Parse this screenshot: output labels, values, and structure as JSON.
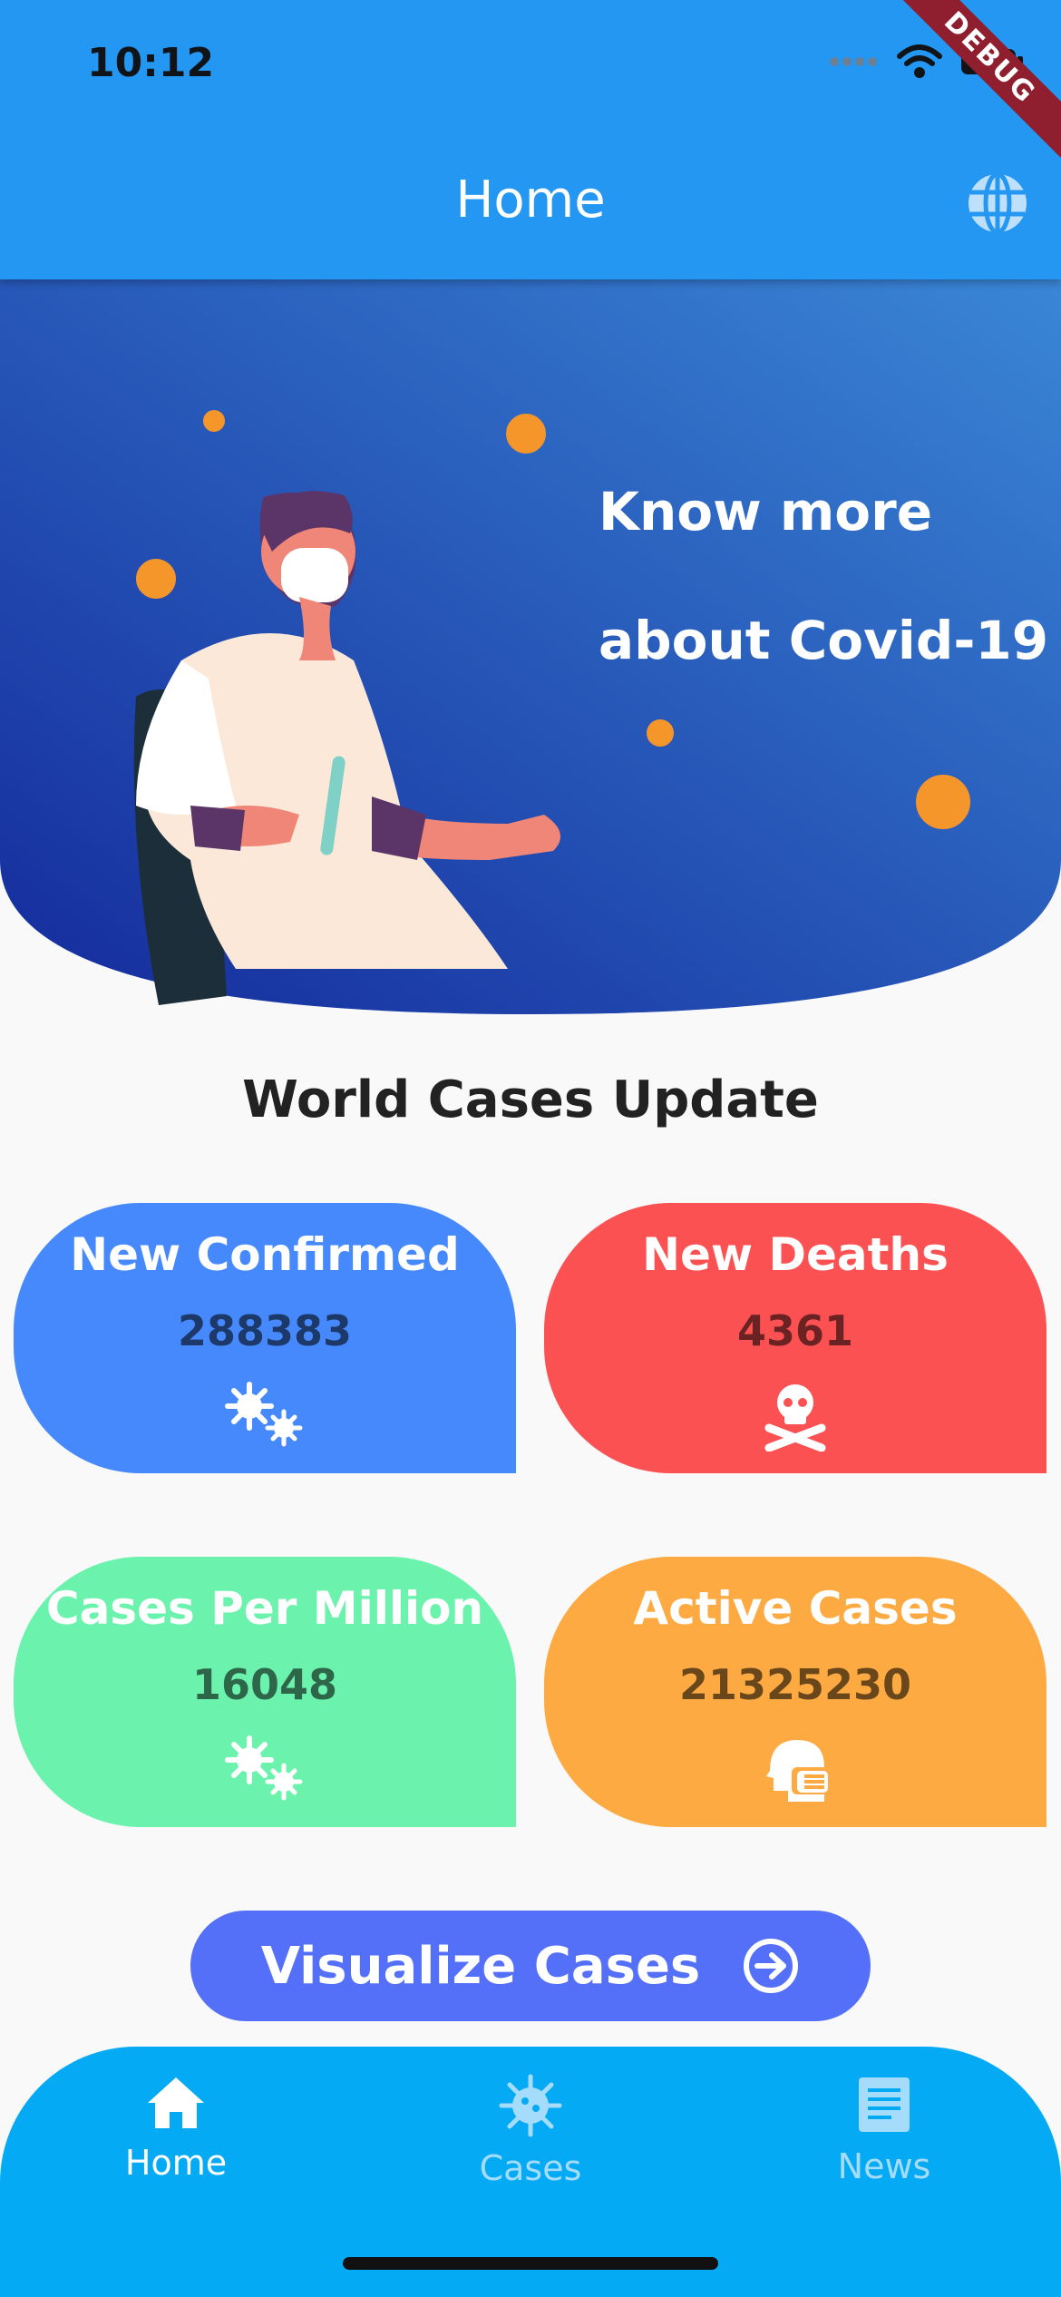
{
  "status_bar": {
    "time": "10:12",
    "debug_label": "DEBUG"
  },
  "app_bar": {
    "title": "Home",
    "globe_icon": "globe-icon"
  },
  "hero": {
    "line1": "Know more",
    "line2": "about Covid-19",
    "gradient_start": "#142a9b",
    "gradient_end": "#3a86d6",
    "virus_color": "#f5962b"
  },
  "section": {
    "title": "World Cases Update"
  },
  "cards": [
    {
      "label": "New Confirmed",
      "value": "288383",
      "icon": "virus-cells-icon",
      "color": "#4689fc"
    },
    {
      "label": "New Deaths",
      "value": "4361",
      "icon": "skull-crossbones-icon",
      "color": "#fc5152"
    },
    {
      "label": "Cases Per Million",
      "value": "16048",
      "icon": "virus-cells-icon",
      "color": "#6bf3ae"
    },
    {
      "label": "Active Cases",
      "value": "21325230",
      "icon": "head-mask-icon",
      "color": "#fdaa42"
    }
  ],
  "visualize_button": {
    "label": "Visualize Cases",
    "icon": "arrow-circle-right-icon"
  },
  "bottom_nav": {
    "items": [
      {
        "label": "Home",
        "icon": "home-icon",
        "active": true
      },
      {
        "label": "Cases",
        "icon": "virus-icon",
        "active": false
      },
      {
        "label": "News",
        "icon": "newspaper-icon",
        "active": false
      }
    ],
    "background": "#05aaf4"
  }
}
